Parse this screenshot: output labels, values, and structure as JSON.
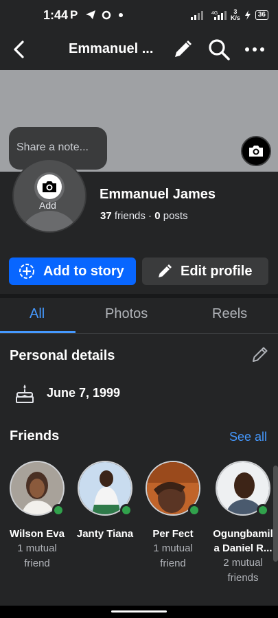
{
  "status_bar": {
    "time": "1:44",
    "left_icons": "P ◢ O •",
    "network_label": "4G",
    "speed_value": "3",
    "speed_unit": "K/s",
    "battery": "36"
  },
  "nav": {
    "title": "Emmanuel ...",
    "icons": [
      "back-arrow-icon",
      "pencil-icon",
      "search-icon",
      "more-icon"
    ]
  },
  "note": {
    "placeholder": "Share a note..."
  },
  "avatar": {
    "add_label": "Add"
  },
  "profile": {
    "name": "Emmanuel James",
    "friends_count": "37",
    "friends_label": " friends · ",
    "posts_count": "0",
    "posts_label": " posts"
  },
  "actions": {
    "add_story": "Add to story",
    "edit_profile": "Edit profile"
  },
  "tabs": [
    {
      "label": "All",
      "active": true
    },
    {
      "label": "Photos",
      "active": false
    },
    {
      "label": "Reels",
      "active": false
    }
  ],
  "personal_details": {
    "title": "Personal details",
    "birthday": "June 7, 1999"
  },
  "friends": {
    "title": "Friends",
    "see_all": "See all",
    "list": [
      {
        "name": "Wilson Eva",
        "mutual_1": "1 mutual",
        "mutual_2": "friend",
        "online": true
      },
      {
        "name": "Janty Tiana",
        "mutual_1": "",
        "mutual_2": "",
        "online": true
      },
      {
        "name": "Per Fect",
        "mutual_1": "1 mutual",
        "mutual_2": "friend",
        "online": true
      },
      {
        "name_1": "Ogungbamil",
        "name_2": "a Daniel R...",
        "mutual_1": "2 mutual",
        "mutual_2": "friends",
        "online": true
      }
    ]
  },
  "colors": {
    "background": "#242526",
    "accent_blue": "#0866ff",
    "link_blue": "#4599ff",
    "online_green": "#31a24c"
  }
}
